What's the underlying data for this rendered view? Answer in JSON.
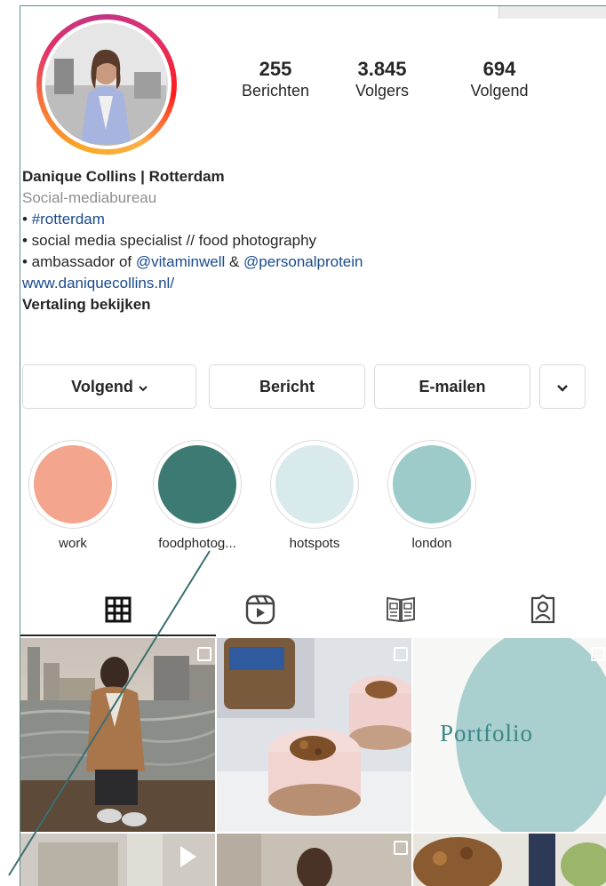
{
  "profile": {
    "stats": [
      {
        "value": "255",
        "label": "Berichten"
      },
      {
        "value": "3.845",
        "label": "Volgers"
      },
      {
        "value": "694",
        "label": "Volgend"
      }
    ],
    "name": "Danique Collins | Rotterdam",
    "category": "Social-mediabureau",
    "bio": {
      "line1_bullet": "• ",
      "line1_tag": "#rotterdam",
      "line2": "• social media specialist // food photography",
      "line3_prefix": "• ambassador of ",
      "line3_mention1": "@vitaminwell",
      "line3_mid": " & ",
      "line3_mention2": "@personalprotein",
      "website": "www.daniquecollins.nl/",
      "translate": "Vertaling bekijken"
    }
  },
  "actions": {
    "following": "Volgend",
    "message": "Bericht",
    "email": "E-mailen"
  },
  "highlights": [
    {
      "label": "work",
      "color": "#f4a58e"
    },
    {
      "label": "foodphotog...",
      "color": "#3e7a74"
    },
    {
      "label": "hotspots",
      "color": "#d8eaec"
    },
    {
      "label": "london",
      "color": "#9ccbca"
    }
  ],
  "tabs": [
    {
      "icon": "grid-icon",
      "active": true
    },
    {
      "icon": "reels-icon",
      "active": false
    },
    {
      "icon": "guides-icon",
      "active": false
    },
    {
      "icon": "tagged-icon",
      "active": false
    }
  ],
  "posts": {
    "portfolio_text": "Portfolio"
  },
  "colors": {
    "link": "#1a4a8a",
    "muted": "#8e8e8e",
    "portfolio_bg": "#a9cfcf",
    "portfolio_text": "#3c8787",
    "annotation_line": "#3c6f72"
  }
}
